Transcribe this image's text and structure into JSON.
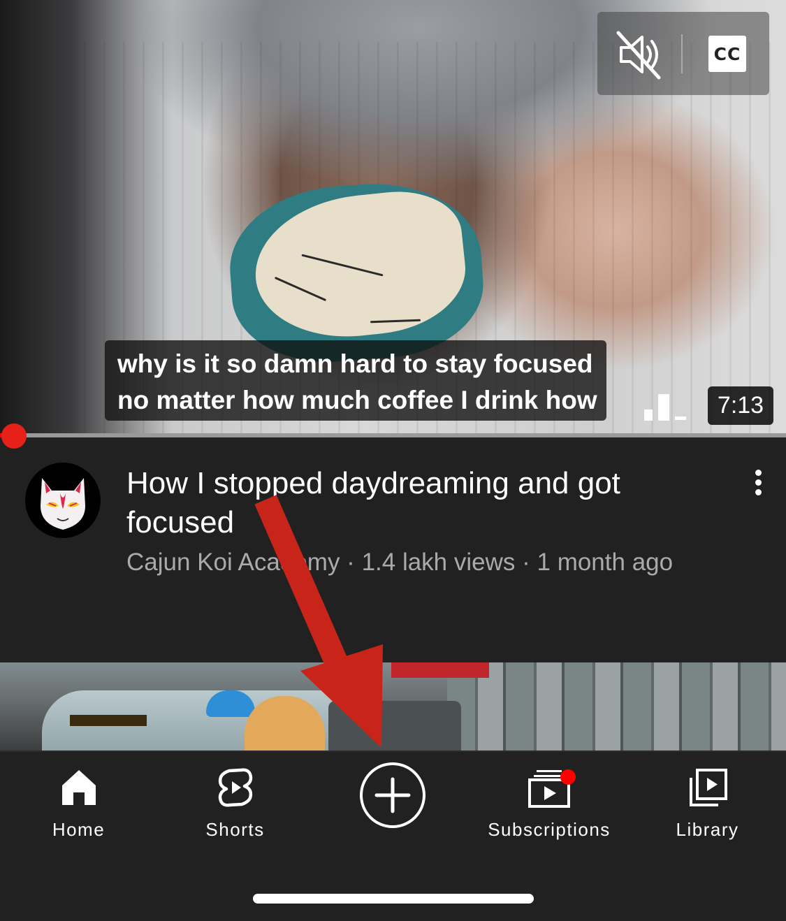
{
  "player": {
    "caption_lines": [
      "why is it so damn hard to stay focused",
      "no matter how much coffee I drink how"
    ],
    "duration": "7:13",
    "cc_label": "CC",
    "mute_icon": "volume-off-icon",
    "progress_fraction": 0.018,
    "progress_color": "#ff0000"
  },
  "video": {
    "title": "How I stopped daydreaming and got focused",
    "channel": "Cajun Koi Academy",
    "views": "1.4 lakh views",
    "age": "1 month ago",
    "separator": " · "
  },
  "bottom_nav": {
    "home": "Home",
    "shorts": "Shorts",
    "subscriptions": "Subscriptions",
    "library": "Library",
    "create_icon": "plus-circle-icon",
    "notification_color": "#ff0000"
  },
  "annotation": {
    "arrow_color": "#c8241a",
    "points_to": "create-button"
  }
}
